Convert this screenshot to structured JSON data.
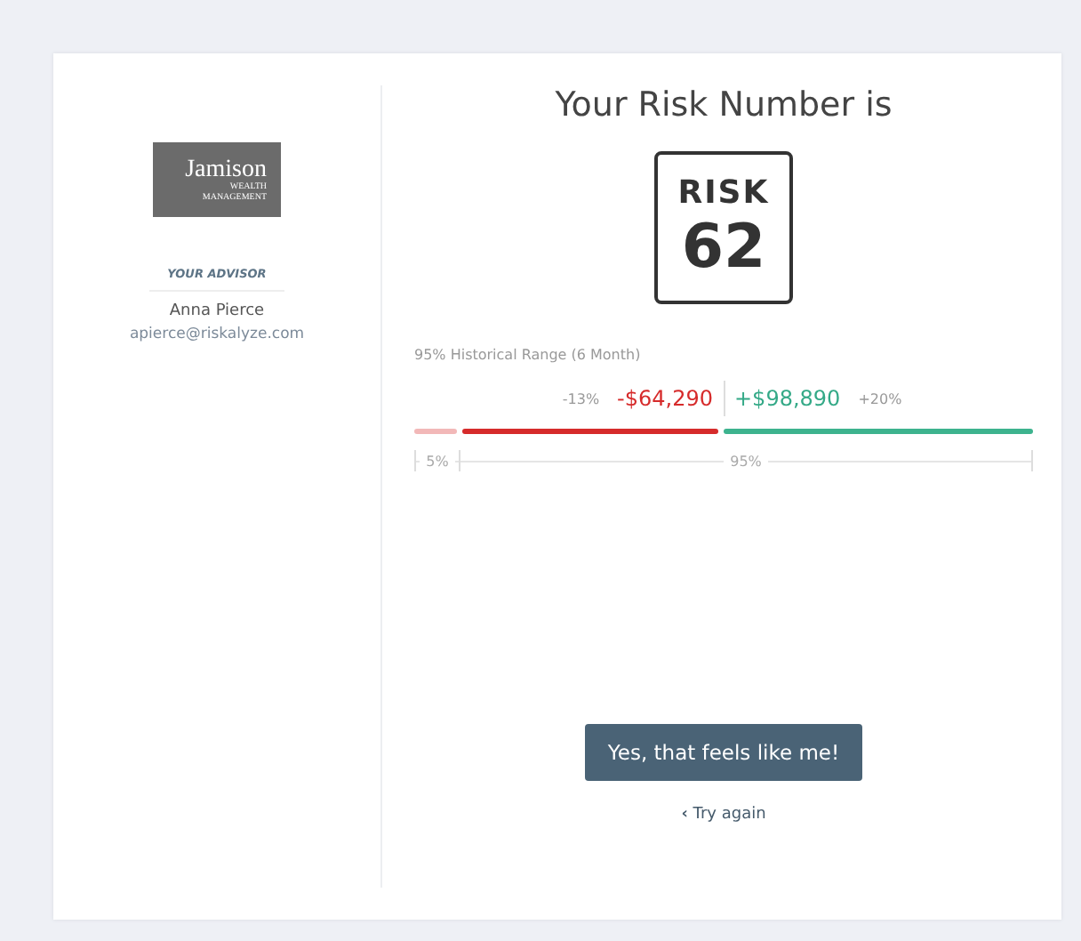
{
  "advisor": {
    "logo": {
      "name": "Jamison",
      "line_1": "WEALTH",
      "line_2": "MANAGEMENT"
    },
    "heading": "YOUR ADVISOR",
    "name": "Anna Pierce",
    "email": "apierce@riskalyze.com"
  },
  "result": {
    "title": "Your Risk Number is",
    "sign_label": "RISK",
    "number": "62"
  },
  "range": {
    "caption": "95% Historical Range (6 Month)",
    "loss_percent": "-13%",
    "loss_amount": "-$64,290",
    "gain_amount": "+$98,890",
    "gain_percent": "+20%",
    "tail_label": "5%",
    "main_label": "95%"
  },
  "actions": {
    "confirm": "Yes, that feels like me!",
    "back_icon": "‹",
    "back": "Try again"
  }
}
